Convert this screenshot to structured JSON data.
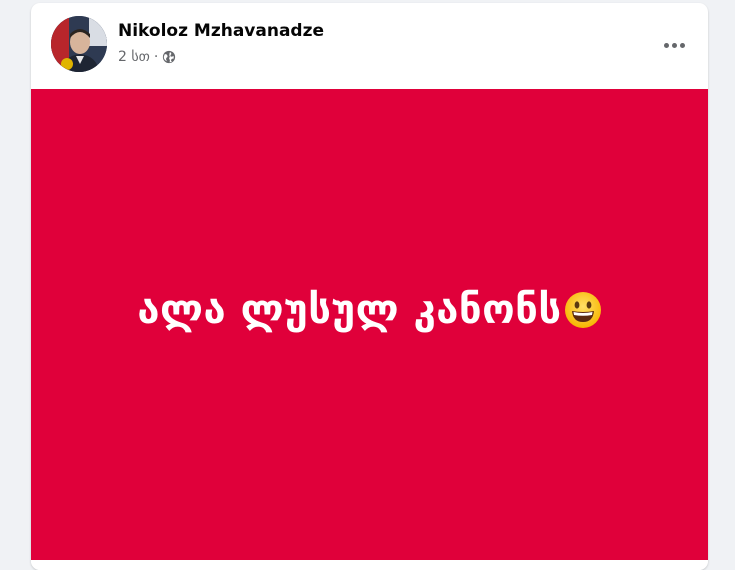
{
  "post": {
    "author": "Nikoloz Mzhavanadze",
    "time": "2 სთ",
    "separator": "·",
    "privacy_icon": "globe-icon",
    "more_icon": "more-horizontal-icon",
    "image_text": "ალა ლუსულ კანონს",
    "emoji": "grinning-face-emoji",
    "image_background": "#e0003a",
    "image_text_color": "#ffffff"
  }
}
